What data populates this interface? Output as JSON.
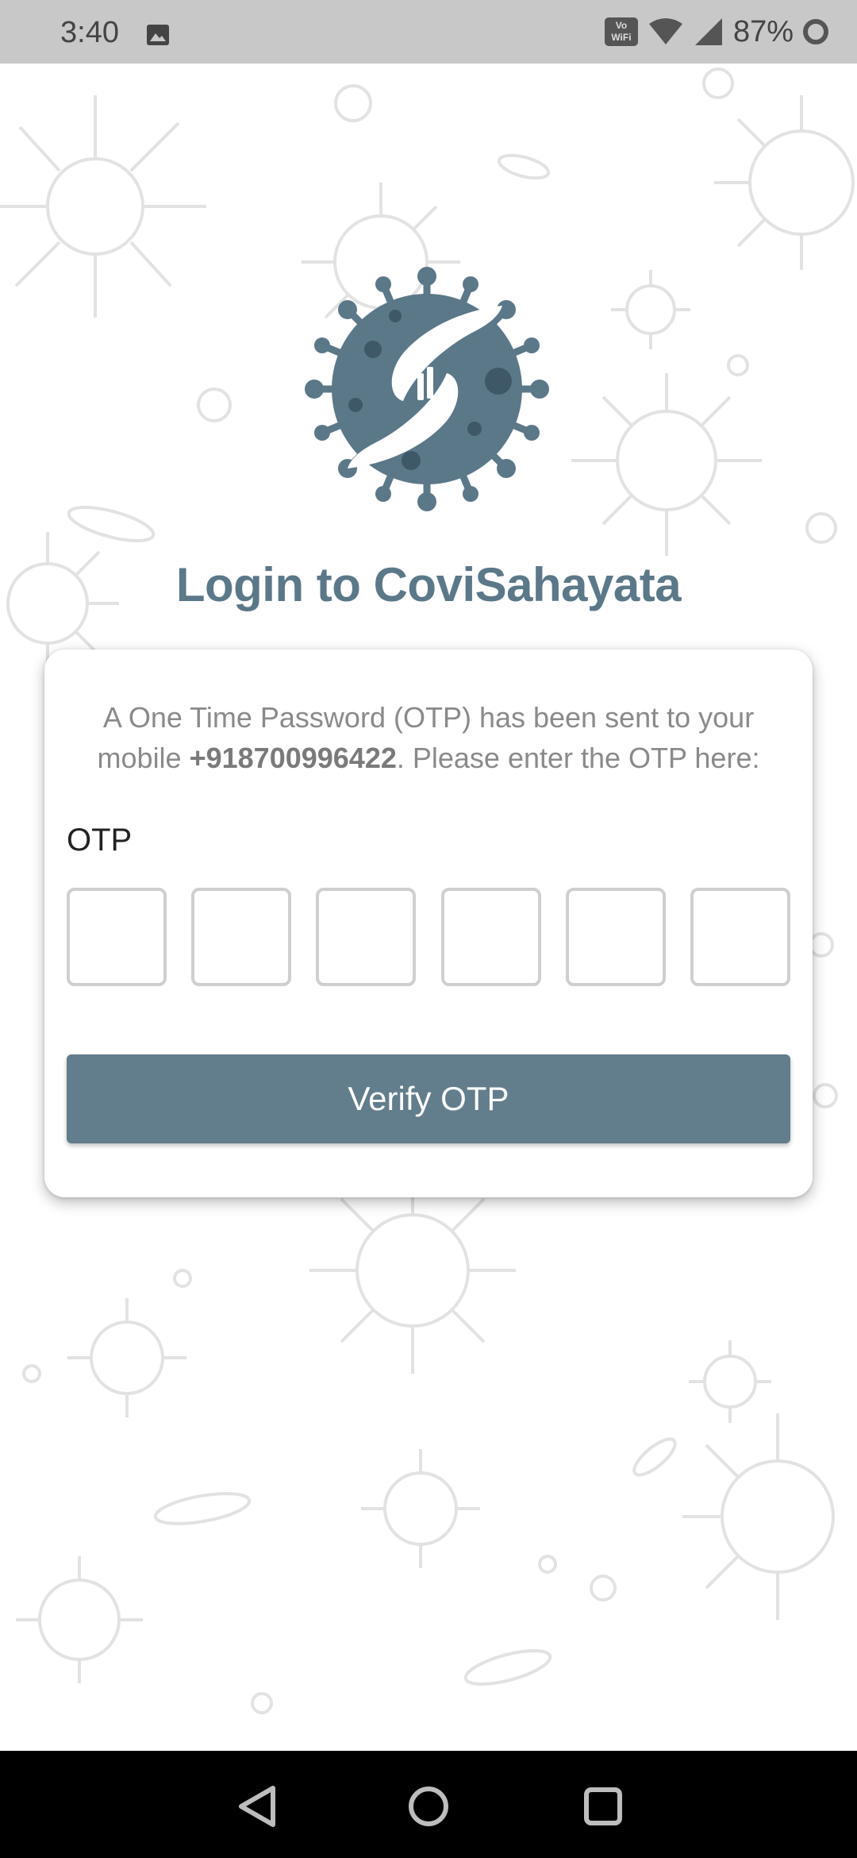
{
  "status_bar": {
    "time": "3:40",
    "vowifi_line1": "Vo",
    "vowifi_line2": "WiFi",
    "battery": "87%",
    "icons": [
      "gallery-icon",
      "vowifi-icon",
      "wifi-icon",
      "cellular-signal-icon",
      "battery-icon"
    ]
  },
  "logo": {
    "icon": "covisahayata-logo-icon"
  },
  "page": {
    "title": "Login to CoviSahayata"
  },
  "card": {
    "message_prefix": "A One Time Password (OTP) has been sent to your mobile ",
    "phone": "+918700996422",
    "message_suffix": ". Please enter the OTP here:",
    "otp_label": "OTP",
    "otp_digits": [
      "",
      "",
      "",
      "",
      "",
      ""
    ],
    "verify_label": "Verify OTP"
  },
  "colors": {
    "accent": "#627d8b",
    "title": "#5b7889",
    "status_bar": "#c8c8c8",
    "nav_bar": "#000000"
  },
  "nav_bar": {
    "icons": [
      "back-icon",
      "home-icon",
      "recents-icon"
    ]
  }
}
